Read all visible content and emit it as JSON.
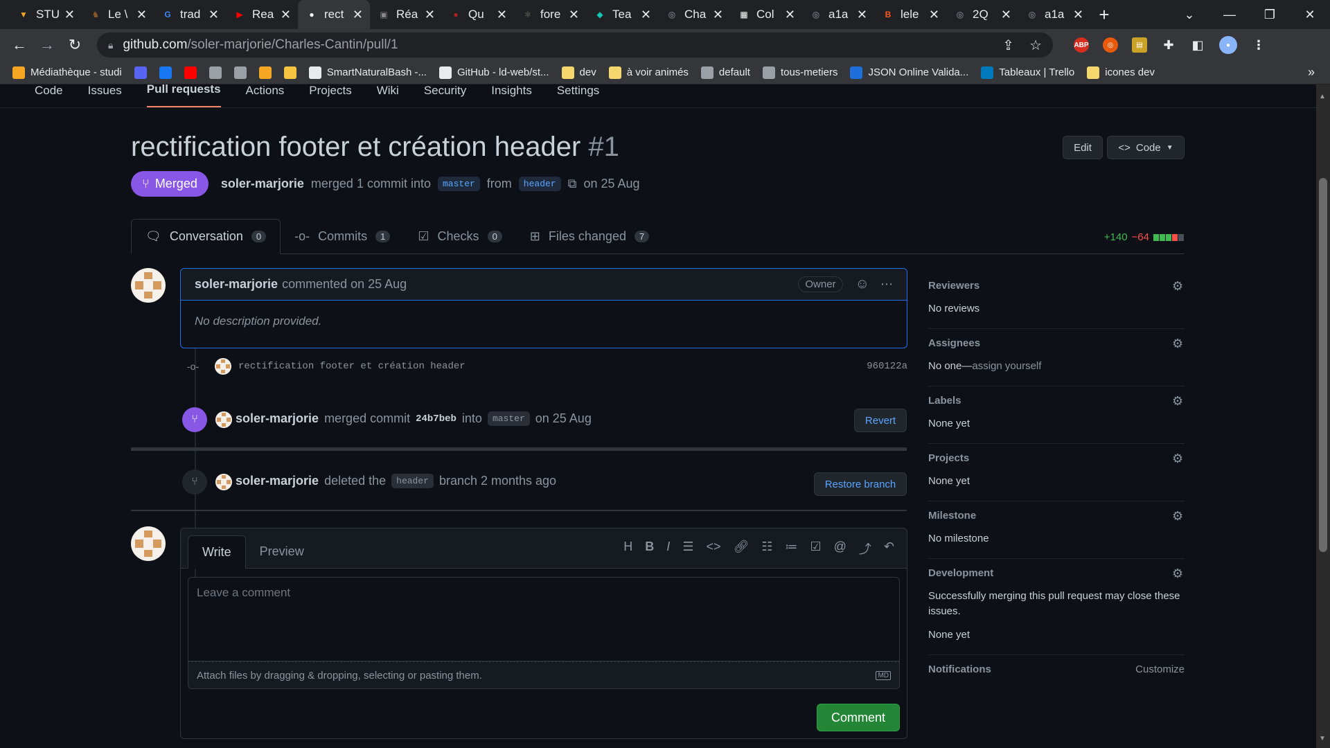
{
  "browser": {
    "tabs": [
      {
        "label": "STU",
        "color": "#f5a623",
        "glyph": "▼"
      },
      {
        "label": "Le \\",
        "color": "#8b5a2b",
        "glyph": "♞"
      },
      {
        "label": "trad",
        "color": "#4285f4",
        "glyph": "G"
      },
      {
        "label": "Rea",
        "color": "#ff0000",
        "glyph": "▶"
      },
      {
        "label": "rect",
        "color": "#ffffff",
        "glyph": "●"
      },
      {
        "label": "Réa",
        "color": "#888888",
        "glyph": "▣"
      },
      {
        "label": "Qu",
        "color": "#b22222",
        "glyph": "●"
      },
      {
        "label": "fore",
        "color": "#444444",
        "glyph": "✱"
      },
      {
        "label": "Tea",
        "color": "#17c3b2",
        "glyph": "◆"
      },
      {
        "label": "Cha",
        "color": "#9aa0a6",
        "glyph": "◎"
      },
      {
        "label": "Col",
        "color": "#ffffff",
        "glyph": "▦"
      },
      {
        "label": "a1a",
        "color": "#9aa0a6",
        "glyph": "◎"
      },
      {
        "label": "lele",
        "color": "#ff5722",
        "glyph": "B"
      },
      {
        "label": "2Q",
        "color": "#9aa0a6",
        "glyph": "◎"
      },
      {
        "label": "a1a",
        "color": "#9aa0a6",
        "glyph": "◎"
      }
    ],
    "active_tab": 4,
    "url_domain": "github.com",
    "url_path": "/soler-marjorie/Charles-Cantin/pull/1",
    "bookmarks": [
      {
        "label": "Médiathèque - studi",
        "color": "#f5a623"
      },
      {
        "label": "",
        "color": "#5865f2"
      },
      {
        "label": "",
        "color": "#1877f2"
      },
      {
        "label": "",
        "color": "#ff0000"
      },
      {
        "label": "",
        "color": "#9aa0a6"
      },
      {
        "label": "",
        "color": "#9aa0a6"
      },
      {
        "label": "",
        "color": "#f5a623"
      },
      {
        "label": "",
        "color": "#f5c542"
      },
      {
        "label": "SmartNaturalBash -...",
        "color": "#e8eaed"
      },
      {
        "label": "GitHub - ld-web/st...",
        "color": "#e8eaed"
      },
      {
        "label": "dev",
        "color": "#f5d76e"
      },
      {
        "label": "à voir animés",
        "color": "#f5d76e"
      },
      {
        "label": "default",
        "color": "#9aa0a6"
      },
      {
        "label": "tous-metiers",
        "color": "#9aa0a6"
      },
      {
        "label": "JSON Online Valida...",
        "color": "#1e6fd9"
      },
      {
        "label": "Tableaux | Trello",
        "color": "#0079bf"
      },
      {
        "label": "icones dev",
        "color": "#f5d76e"
      }
    ]
  },
  "repo_nav": [
    "Code",
    "Issues",
    "Pull requests",
    "Actions",
    "Projects",
    "Wiki",
    "Security",
    "Insights",
    "Settings"
  ],
  "pr": {
    "title": "rectification footer et création header",
    "number": "#1",
    "edit_label": "Edit",
    "code_label": "Code",
    "state": "Merged",
    "author": "soler-marjorie",
    "merge_text": "merged 1 commit into",
    "base": "master",
    "from_text": "from",
    "head": "header",
    "date": "on 25 Aug"
  },
  "tabs": [
    {
      "label": "Conversation",
      "count": "0"
    },
    {
      "label": "Commits",
      "count": "1"
    },
    {
      "label": "Checks",
      "count": "0"
    },
    {
      "label": "Files changed",
      "count": "7"
    }
  ],
  "diffstat": {
    "additions": "+140",
    "deletions": "−64"
  },
  "comment": {
    "author": "soler-marjorie",
    "action": "commented on 25 Aug",
    "role": "Owner",
    "body": "No description provided."
  },
  "commit": {
    "message": "rectification footer et création header",
    "sha": "960122a"
  },
  "merged_event": {
    "author": "soler-marjorie",
    "text1": "merged commit",
    "sha": "24b7beb",
    "text2": "into",
    "branch": "master",
    "date": "on 25 Aug",
    "button": "Revert"
  },
  "deleted_event": {
    "author": "soler-marjorie",
    "text1": "deleted the",
    "branch": "header",
    "text2": "branch 2 months ago",
    "button": "Restore branch"
  },
  "editor": {
    "write_tab": "Write",
    "preview_tab": "Preview",
    "placeholder": "Leave a comment",
    "attach_text": "Attach files by dragging & dropping, selecting or pasting them.",
    "md_badge": "MD",
    "submit": "Comment"
  },
  "sidebar": {
    "reviewers": {
      "title": "Reviewers",
      "value": "No reviews"
    },
    "assignees": {
      "title": "Assignees",
      "value": "No one—",
      "link": "assign yourself"
    },
    "labels": {
      "title": "Labels",
      "value": "None yet"
    },
    "projects": {
      "title": "Projects",
      "value": "None yet"
    },
    "milestone": {
      "title": "Milestone",
      "value": "No milestone"
    },
    "development": {
      "title": "Development",
      "desc": "Successfully merging this pull request may close these issues.",
      "value": "None yet"
    },
    "notifications": {
      "title": "Notifications",
      "action": "Customize"
    }
  }
}
